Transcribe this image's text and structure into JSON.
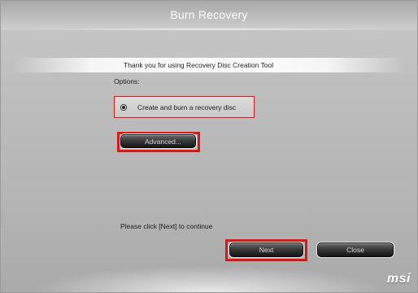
{
  "window": {
    "title": "Burn Recovery"
  },
  "header": {
    "text": "Thank you for using Recovery Disc Creation Tool"
  },
  "options": {
    "label": "Options:",
    "radio_label": "Create and burn a recovery disc",
    "radio_selected": true,
    "advanced_label": "Advanced..."
  },
  "footer": {
    "hint": "Please click [Next] to continue",
    "next_label": "Next",
    "close_label": "Close"
  },
  "branding": {
    "logo": "msi"
  },
  "colors": {
    "highlight": "#e11414",
    "button_dark": "#151515",
    "background": "#bcbcbc"
  }
}
